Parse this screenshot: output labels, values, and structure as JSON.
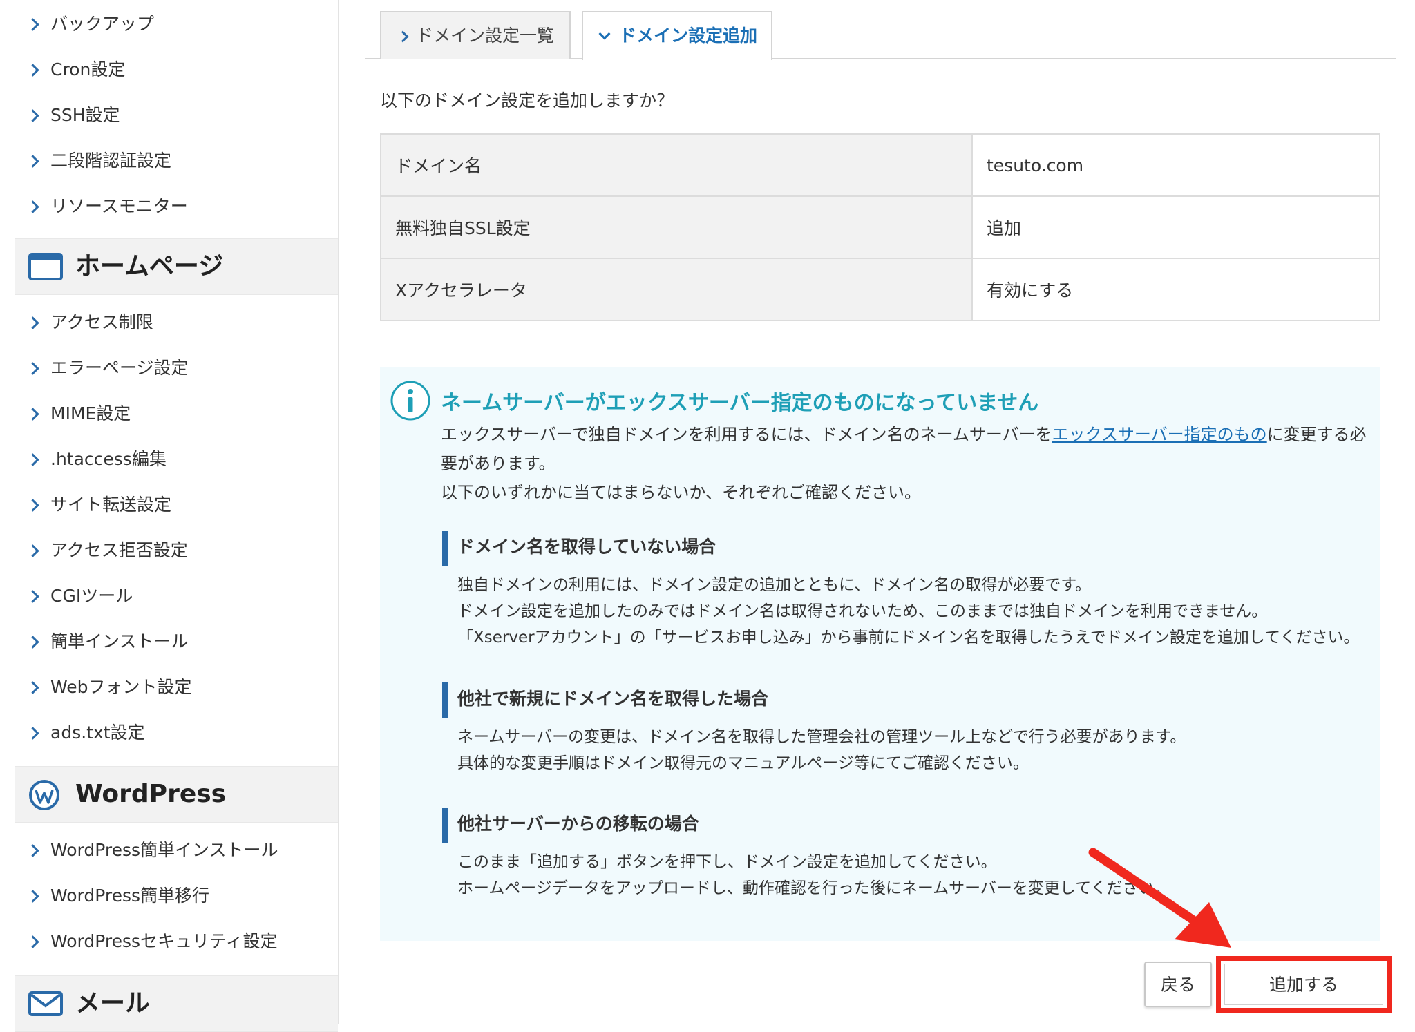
{
  "sidebar": {
    "group1_items": [
      {
        "label": "バックアップ"
      },
      {
        "label": "Cron設定"
      },
      {
        "label": "SSH設定"
      },
      {
        "label": "二段階認証設定"
      },
      {
        "label": "リソースモニター"
      }
    ],
    "homepage_header": "ホームページ",
    "homepage_items": [
      {
        "label": "アクセス制限"
      },
      {
        "label": "エラーページ設定"
      },
      {
        "label": "MIME設定"
      },
      {
        "label": ".htaccess編集"
      },
      {
        "label": "サイト転送設定"
      },
      {
        "label": "アクセス拒否設定"
      },
      {
        "label": "CGIツール"
      },
      {
        "label": "簡単インストール"
      },
      {
        "label": "Webフォント設定"
      },
      {
        "label": "ads.txt設定"
      }
    ],
    "wordpress_header": "WordPress",
    "wordpress_items": [
      {
        "label": "WordPress簡単インストール"
      },
      {
        "label": "WordPress簡単移行"
      },
      {
        "label": "WordPressセキュリティ設定"
      }
    ],
    "mail_header": "メール"
  },
  "tabs": {
    "list_label": "ドメイン設定一覧",
    "add_label": "ドメイン設定追加"
  },
  "confirm": {
    "prompt": "以下のドメイン設定を追加しますか？",
    "rows": [
      {
        "key": "ドメイン名",
        "value": "tesuto.com"
      },
      {
        "key": "無料独自SSL設定",
        "value": "追加"
      },
      {
        "key": "Xアクセラレータ",
        "value": "有効にする"
      }
    ]
  },
  "notice": {
    "title": "ネームサーバーがエックスサーバー指定のものになっていません",
    "desc_before_link": "エックスサーバーで独自ドメインを利用するには、ドメイン名のネームサーバーを",
    "desc_link": "エックスサーバー指定のもの",
    "desc_after_link": "に変更する必要があります。",
    "desc_line2": "以下のいずれかに当てはまらないか、それぞれご確認ください。",
    "sections": [
      {
        "title": "ドメイン名を取得していない場合",
        "lines": [
          "独自ドメインの利用には、ドメイン設定の追加とともに、ドメイン名の取得が必要です。",
          "ドメイン設定を追加したのみではドメイン名は取得されないため、このままでは独自ドメインを利用できません。",
          "「Xserverアカウント」の「サービスお申し込み」から事前にドメイン名を取得したうえでドメイン設定を追加してください。"
        ]
      },
      {
        "title": "他社で新規にドメイン名を取得した場合",
        "lines": [
          "ネームサーバーの変更は、ドメイン名を取得した管理会社の管理ツール上などで行う必要があります。",
          "具体的な変更手順はドメイン取得元のマニュアルページ等にてご確認ください。"
        ]
      },
      {
        "title": "他社サーバーからの移転の場合",
        "lines": [
          "このまま「追加する」ボタンを押下し、ドメイン設定を追加してください。",
          "ホームページデータをアップロードし、動作確認を行った後にネームサーバーを変更してください。"
        ]
      }
    ]
  },
  "buttons": {
    "back": "戻る",
    "add": "追加する"
  },
  "colors": {
    "accent_blue": "#1b6fb5",
    "notice_teal": "#1e9fb6",
    "highlight_red": "#f0281e"
  }
}
